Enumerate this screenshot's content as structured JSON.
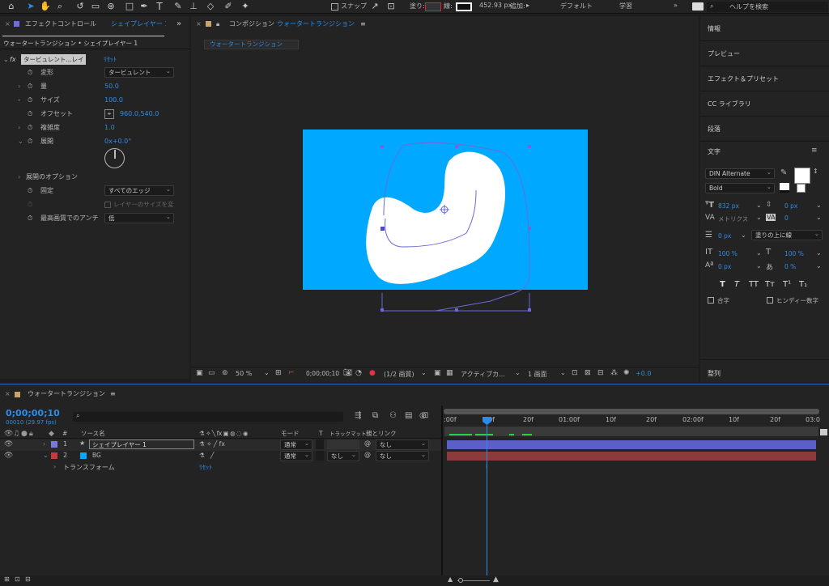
{
  "toolbar": {
    "snap_label": "スナップ",
    "fill_label": "塗り:",
    "stroke_width": "452.93 px",
    "add_label": "追加:",
    "workspace_default": "デフォルト",
    "workspace_learn": "学習",
    "search_placeholder": "ヘルプを検索"
  },
  "effect_controls": {
    "tab_label": "エフェクトコントロール",
    "tab_target": "シェイプレイヤー 1",
    "breadcrumb": "ウォータートランジション • シェイプレイヤー 1",
    "effect_name": "タービュレント...レイス",
    "reset_label": "ﾘｾｯﾄ",
    "props": [
      {
        "label": "変形",
        "value": "タービュレント"
      },
      {
        "label": "量",
        "value": "50.0"
      },
      {
        "label": "サイズ",
        "value": "100.0"
      },
      {
        "label": "オフセット",
        "value": "960.0,540.0"
      },
      {
        "label": "複雑度",
        "value": "1.0"
      },
      {
        "label": "展開",
        "value": "0x+0.0°"
      },
      {
        "label": "展開のオプション",
        "value": ""
      },
      {
        "label": "固定",
        "value": "すべてのエッジ"
      },
      {
        "label": "",
        "value": "レイヤーのサイズを変"
      },
      {
        "label": "最高画質でのアンチ",
        "value": "低"
      }
    ]
  },
  "composition": {
    "tab_label": "コンポジション",
    "tab_name": "ウォータートランジション",
    "subtab": "ウォータートランジション",
    "bg_color": "#00a9ff",
    "shape_color": "#ffffff",
    "bottom_bar": {
      "zoom": "50 %",
      "timecode": "0;00;00;10",
      "resolution": "(1/2 画質)",
      "camera": "アクティブカ...",
      "views": "1 画面",
      "exposure": "+0.0"
    }
  },
  "right_panel": {
    "items": [
      "情報",
      "プレビュー",
      "エフェクト＆プリセット",
      "CC ライブラリ",
      "段落"
    ],
    "text_title": "文字",
    "font": "DIN Alternate",
    "style": "Bold",
    "size": "832 px",
    "leading": "0 px",
    "kerning": "メトリクス",
    "tracking": "0",
    "stroke": "0 px",
    "stroke_type": "塗りの上に線",
    "v_scale": "100 %",
    "h_scale": "100 %",
    "baseline": "0 px",
    "tsume": "0 %",
    "ligature": "合字",
    "hindi": "ヒンディー数字",
    "align_title": "整列",
    "styles": [
      "T",
      "T",
      "TT",
      "Tт",
      "T¹",
      "T₁"
    ]
  },
  "timeline": {
    "tab": "ウォータートランジション",
    "timecode": "0;00;00;10",
    "frames": "00010 (29.97 fps)",
    "col_source": "ソース名",
    "col_mode": "モード",
    "col_t": "T",
    "col_trkmat": "トラックマット",
    "col_parent": "親とリンク",
    "ruler": [
      ":00f",
      "10f",
      "20f",
      "01:00f",
      "10f",
      "20f",
      "02:00f",
      "10f",
      "20f",
      "03:0"
    ],
    "layers": [
      {
        "num": "1",
        "name": "シェイプレイヤー 1",
        "mode": "通常",
        "trkmat": "",
        "parent": "なし",
        "color": "#7a7ad8",
        "bar": "#5b5fc7"
      },
      {
        "num": "2",
        "name": "BG",
        "mode": "通常",
        "trkmat": "なし",
        "parent": "なし",
        "color": "#c93b3b",
        "bar": "#8c3b3b"
      }
    ],
    "transform_label": "トランスフォーム",
    "transform_reset": "ﾘｾｯﾄ"
  }
}
